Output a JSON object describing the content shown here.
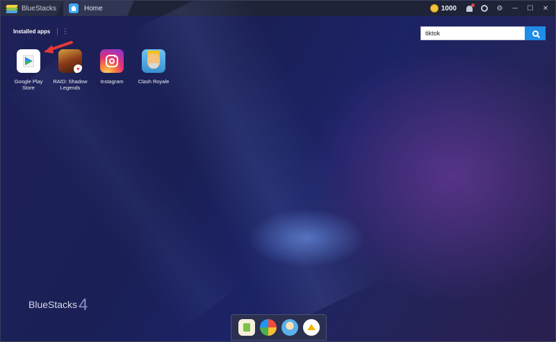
{
  "titlebar": {
    "app_name": "BlueStacks",
    "home_tab": "Home",
    "coins": "1000"
  },
  "content": {
    "installed_title": "Installed apps",
    "kebab": "⋮",
    "apps": [
      {
        "label": "Google Play Store"
      },
      {
        "label": "RAID: Shadow Legends"
      },
      {
        "label": "Instagram"
      },
      {
        "label": "Clash Royale"
      }
    ],
    "search": {
      "value": "tiktok"
    },
    "brand": {
      "text": "BlueStacks",
      "version": "4"
    }
  },
  "colors": {
    "accent": "#1f8ce6",
    "titlebar": "#1f2338",
    "bluestacks_green": "#8bc34a"
  }
}
